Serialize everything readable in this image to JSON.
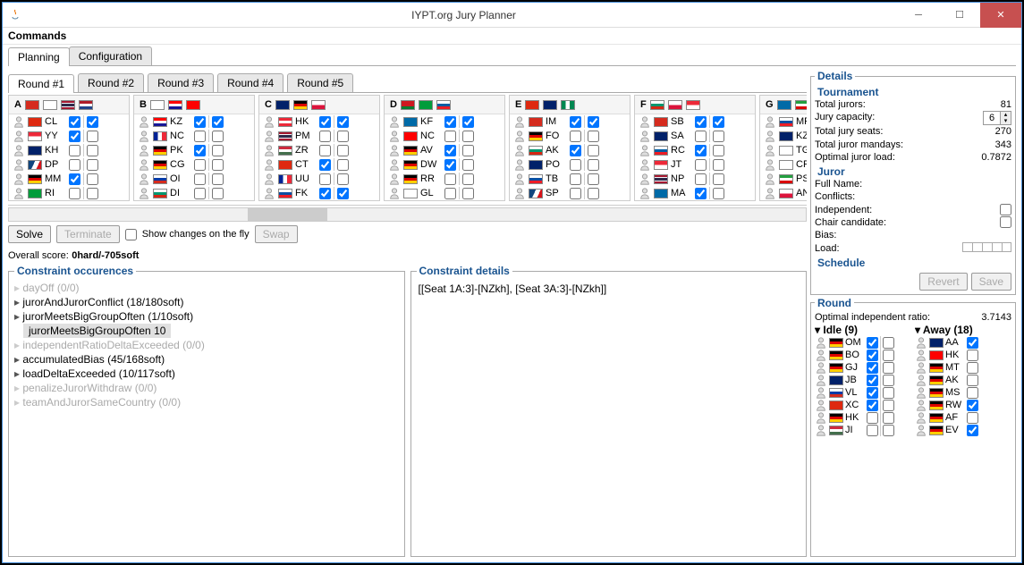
{
  "window": {
    "title": "IYPT.org Jury Planner"
  },
  "menubar": {
    "commands": "Commands"
  },
  "tabs": {
    "planning": "Planning",
    "configuration": "Configuration"
  },
  "round_tabs": [
    "Round #1",
    "Round #2",
    "Round #3",
    "Round #4",
    "Round #5"
  ],
  "groups": [
    {
      "label": "A",
      "header_flags": [
        "ch",
        "kr",
        "th",
        "nl"
      ],
      "jurors": [
        {
          "flag": "cn",
          "name": "CL",
          "c1": true,
          "c2": true
        },
        {
          "flag": "sg",
          "name": "YY",
          "c1": true,
          "c2": false
        },
        {
          "flag": "nz",
          "name": "KH",
          "c1": false,
          "c2": false
        },
        {
          "flag": "cz",
          "name": "DP",
          "c1": false,
          "c2": false
        },
        {
          "flag": "de",
          "name": "MM",
          "c1": true,
          "c2": false
        },
        {
          "flag": "br",
          "name": "RI",
          "c1": false,
          "c2": false
        }
      ]
    },
    {
      "label": "B",
      "header_flags": [
        "ge",
        "hr",
        "tw"
      ],
      "jurors": [
        {
          "flag": "hr",
          "name": "KZ",
          "c1": true,
          "c2": true
        },
        {
          "flag": "fr",
          "name": "NC",
          "c1": false,
          "c2": false
        },
        {
          "flag": "de",
          "name": "PK",
          "c1": true,
          "c2": false
        },
        {
          "flag": "de",
          "name": "CG",
          "c1": false,
          "c2": false
        },
        {
          "flag": "ru",
          "name": "OI",
          "c1": false,
          "c2": false
        },
        {
          "flag": "bg",
          "name": "DI",
          "c1": false,
          "c2": false
        }
      ]
    },
    {
      "label": "C",
      "header_flags": [
        "nz",
        "de",
        "pl"
      ],
      "jurors": [
        {
          "flag": "at",
          "name": "HK",
          "c1": true,
          "c2": true
        },
        {
          "flag": "th",
          "name": "PM",
          "c1": false,
          "c2": false
        },
        {
          "flag": "hu",
          "name": "ZR",
          "c1": false,
          "c2": false
        },
        {
          "flag": "cn",
          "name": "CT",
          "c1": true,
          "c2": false
        },
        {
          "flag": "fr",
          "name": "UU",
          "c1": false,
          "c2": false
        },
        {
          "flag": "sk",
          "name": "FK",
          "c1": true,
          "c2": true
        }
      ]
    },
    {
      "label": "D",
      "header_flags": [
        "by",
        "br",
        "si"
      ],
      "jurors": [
        {
          "flag": "se",
          "name": "KF",
          "c1": true,
          "c2": true
        },
        {
          "flag": "tw",
          "name": "NC",
          "c1": false,
          "c2": false
        },
        {
          "flag": "de",
          "name": "AV",
          "c1": true,
          "c2": false
        },
        {
          "flag": "de",
          "name": "DW",
          "c1": true,
          "c2": false
        },
        {
          "flag": "de",
          "name": "RR",
          "c1": false,
          "c2": false
        },
        {
          "flag": "ge",
          "name": "GL",
          "c1": false,
          "c2": false
        }
      ]
    },
    {
      "label": "E",
      "header_flags": [
        "cn",
        "gb",
        "ng"
      ],
      "jurors": [
        {
          "flag": "ch",
          "name": "IM",
          "c1": true,
          "c2": true
        },
        {
          "flag": "de",
          "name": "FO",
          "c1": false,
          "c2": false
        },
        {
          "flag": "bg",
          "name": "AK",
          "c1": true,
          "c2": false
        },
        {
          "flag": "nz",
          "name": "PO",
          "c1": false,
          "c2": false
        },
        {
          "flag": "sk",
          "name": "TB",
          "c1": false,
          "c2": false
        },
        {
          "flag": "cz",
          "name": "SP",
          "c1": false,
          "c2": false
        }
      ]
    },
    {
      "label": "F",
      "header_flags": [
        "bg",
        "pl",
        "sg"
      ],
      "jurors": [
        {
          "flag": "ch",
          "name": "SB",
          "c1": true,
          "c2": true
        },
        {
          "flag": "gb",
          "name": "SA",
          "c1": false,
          "c2": false
        },
        {
          "flag": "si",
          "name": "RC",
          "c1": true,
          "c2": false
        },
        {
          "flag": "sg",
          "name": "JT",
          "c1": false,
          "c2": false
        },
        {
          "flag": "th",
          "name": "NP",
          "c1": false,
          "c2": false
        },
        {
          "flag": "se",
          "name": "MA",
          "c1": true,
          "c2": false
        }
      ]
    },
    {
      "label": "G",
      "header_flags": [
        "se",
        "ir",
        "hu"
      ],
      "jurors": [
        {
          "flag": "sk",
          "name": "MP",
          "c1": true
        },
        {
          "flag": "nz",
          "name": "KZ",
          "c1": false
        },
        {
          "flag": "ge",
          "name": "TG",
          "c1": false
        },
        {
          "flag": "kr",
          "name": "CP",
          "c1": true
        },
        {
          "flag": "ir",
          "name": "PS",
          "c1": false
        },
        {
          "flag": "pl",
          "name": "AN",
          "c1": false
        }
      ]
    }
  ],
  "controls": {
    "solve": "Solve",
    "terminate": "Terminate",
    "show_changes": "Show changes on the fly",
    "swap": "Swap"
  },
  "score": {
    "label": "Overall score:",
    "value": "0hard/-705soft"
  },
  "constraints": {
    "title": "Constraint occurences",
    "items": [
      {
        "text": "dayOff (0/0)",
        "gray": true
      },
      {
        "text": "jurorAndJurorConflict (18/180soft)",
        "gray": false
      },
      {
        "text": "jurorMeetsBigGroupOften (1/10soft)",
        "gray": false,
        "expanded": true,
        "child": "jurorMeetsBigGroupOften 10"
      },
      {
        "text": "independentRatioDeltaExceeded (0/0)",
        "gray": true
      },
      {
        "text": "accumulatedBias (45/168soft)",
        "gray": false
      },
      {
        "text": "loadDeltaExceeded (10/117soft)",
        "gray": false
      },
      {
        "text": "penalizeJurorWithdraw (0/0)",
        "gray": true
      },
      {
        "text": "teamAndJurorSameCountry (0/0)",
        "gray": true
      }
    ]
  },
  "constraint_details": {
    "title": "Constraint details",
    "text": "[[Seat 1A:3]-[NZkh], [Seat 3A:3]-[NZkh]]"
  },
  "details": {
    "title": "Details",
    "tournament": {
      "title": "Tournament",
      "total_jurors_label": "Total jurors:",
      "total_jurors": "81",
      "jury_capacity_label": "Jury capacity:",
      "jury_capacity": "6",
      "total_seats_label": "Total jury seats:",
      "total_seats": "270",
      "total_mandays_label": "Total juror mandays:",
      "total_mandays": "343",
      "optimal_load_label": "Optimal juror load:",
      "optimal_load": "0.7872"
    },
    "juror": {
      "title": "Juror",
      "fullname": "Full Name:",
      "conflicts": "Conflicts:",
      "independent": "Independent:",
      "chair": "Chair candidate:",
      "bias": "Bias:",
      "load": "Load:"
    },
    "schedule": {
      "title": "Schedule",
      "revert": "Revert",
      "save": "Save"
    }
  },
  "round_panel": {
    "title": "Round",
    "opt_ratio_label": "Optimal independent ratio:",
    "opt_ratio": "3.7143",
    "idle_label": "Idle (9)",
    "away_label": "Away (18)",
    "idle": [
      {
        "flag": "de",
        "name": "OM",
        "c": true
      },
      {
        "flag": "de",
        "name": "BO",
        "c": true
      },
      {
        "flag": "de",
        "name": "GJ",
        "c": true
      },
      {
        "flag": "gb",
        "name": "JB",
        "c": true
      },
      {
        "flag": "ru",
        "name": "VL",
        "c": true
      },
      {
        "flag": "cn",
        "name": "XC",
        "c": true
      },
      {
        "flag": "de",
        "name": "HK",
        "c": false
      },
      {
        "flag": "hu",
        "name": "JI",
        "c": false
      }
    ],
    "away": [
      {
        "flag": "nz",
        "name": "AA",
        "c": true
      },
      {
        "flag": "tw",
        "name": "HK",
        "c": false
      },
      {
        "flag": "de",
        "name": "MT",
        "c": false
      },
      {
        "flag": "de",
        "name": "AK",
        "c": false
      },
      {
        "flag": "de",
        "name": "MS",
        "c": false
      },
      {
        "flag": "de",
        "name": "RW",
        "c": true
      },
      {
        "flag": "de",
        "name": "AF",
        "c": false
      },
      {
        "flag": "de",
        "name": "EV",
        "c": true
      }
    ]
  },
  "flags": {
    "ch": "linear-gradient(#d52b1e,#d52b1e)",
    "kr": "linear-gradient(#fff,#fff)",
    "th": "linear-gradient(#a51931 20%,#f4f5f8 20% 35%,#2d2a4a 35% 65%,#f4f5f8 65% 80%,#a51931 80%)",
    "nl": "linear-gradient(#ae1c28 33%,#fff 33% 66%,#21468b 66%)",
    "cn": "linear-gradient(#de2910,#de2910)",
    "sg": "linear-gradient(#ed2939 50%,#fff 50%)",
    "nz": "linear-gradient(#012169,#012169)",
    "cz": "linear-gradient(115deg,#11457e 40%,#fff 40% 70%,#d7141a 70%)",
    "de": "linear-gradient(#000 33%,#dd0000 33% 66%,#ffce00 66%)",
    "br": "linear-gradient(#009c3b,#009c3b)",
    "ge": "linear-gradient(#fff,#fff)",
    "hr": "linear-gradient(#ff0000 33%,#fff 33% 66%,#171796 66%)",
    "tw": "linear-gradient(#fe0000,#fe0000)",
    "fr": "linear-gradient(90deg,#002395 33%,#fff 33% 66%,#ed2939 66%)",
    "ru": "linear-gradient(#fff 33%,#0039a6 33% 66%,#d52b1e 66%)",
    "bg": "linear-gradient(#fff 33%,#00966e 33% 66%,#d62612 66%)",
    "pl": "linear-gradient(#fff 50%,#dc143c 50%)",
    "at": "linear-gradient(#ed2939 33%,#fff 33% 66%,#ed2939 66%)",
    "hu": "linear-gradient(#cd2a3e 33%,#fff 33% 66%,#436f4d 66%)",
    "sk": "linear-gradient(#fff 33%,#0b4ea2 33% 66%,#ee1c25 66%)",
    "by": "linear-gradient(#ce1720 66%,#007c30 66%)",
    "si": "linear-gradient(#fff 33%,#005da4 33% 66%,#ed1c24 66%)",
    "se": "linear-gradient(#006aa7,#006aa7)",
    "gb": "linear-gradient(#012169,#012169)",
    "ng": "linear-gradient(90deg,#008751 33%,#fff 33% 66%,#008751 66%)",
    "ir": "linear-gradient(#239f40 33%,#fff 33% 66%,#da0000 66%)"
  }
}
